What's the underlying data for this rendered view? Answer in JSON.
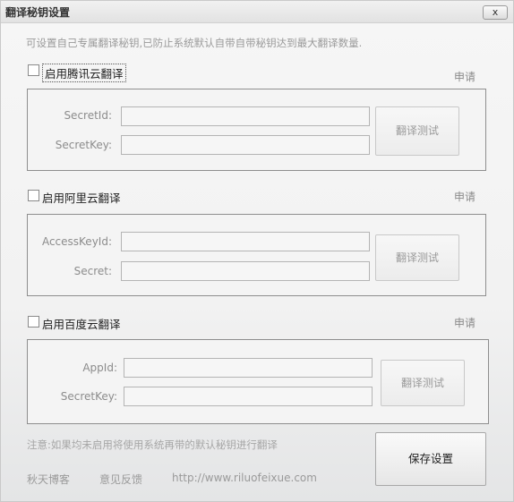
{
  "window": {
    "title": "翻译秘钥设置",
    "close_label": "x"
  },
  "description": "可设置自己专属翻译秘钥,已防止系统默认自带自带秘钥达到最大翻译数量.",
  "apply_label": "申请",
  "test_label": "翻译测试",
  "tencent": {
    "enable_label": "启用腾讯云翻译",
    "checked": false,
    "field1_label": "SecretId:",
    "field1_value": "",
    "field2_label": "SecretKey:",
    "field2_value": ""
  },
  "aliyun": {
    "enable_label": "启用阿里云翻译",
    "checked": false,
    "field1_label": "AccessKeyId:",
    "field1_value": "",
    "field2_label": "Secret:",
    "field2_value": ""
  },
  "baidu": {
    "enable_label": "启用百度云翻译",
    "checked": false,
    "field1_label": "AppId:",
    "field1_value": "",
    "field2_label": "SecretKey:",
    "field2_value": ""
  },
  "note": "注意:如果均未启用将使用系统再带的默认秘钥进行翻译",
  "footer": {
    "blog_label": "秋天博客",
    "feedback_label": "意见反馈",
    "url": "http://www.riluofeixue.com"
  },
  "save_label": "保存设置"
}
